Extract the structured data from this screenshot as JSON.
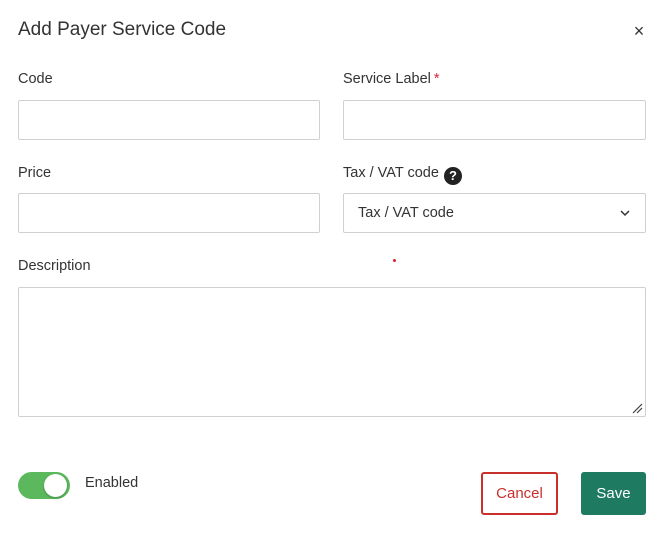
{
  "dialog": {
    "title": "Add Payer Service Code",
    "close_symbol": "×"
  },
  "form": {
    "code": {
      "label": "Code",
      "value": ""
    },
    "service_label": {
      "label": "Service Label",
      "required_marker": "*",
      "value": ""
    },
    "price": {
      "label": "Price",
      "value": ""
    },
    "tax_vat": {
      "label": "Tax / VAT code",
      "help_symbol": "?",
      "selected": "Tax / VAT code"
    },
    "description": {
      "label": "Description",
      "value": ""
    }
  },
  "toggle": {
    "label": "Enabled",
    "on": true,
    "color": "#5cb85c"
  },
  "actions": {
    "cancel_label": "Cancel",
    "save_label": "Save",
    "cancel_color": "#c9302c",
    "save_color": "#1f7a62"
  },
  "icons": {
    "close": "close-icon",
    "help": "question-circle-icon",
    "select_arrow": "chevron-down-icon",
    "resize": "resize-grip-icon"
  }
}
